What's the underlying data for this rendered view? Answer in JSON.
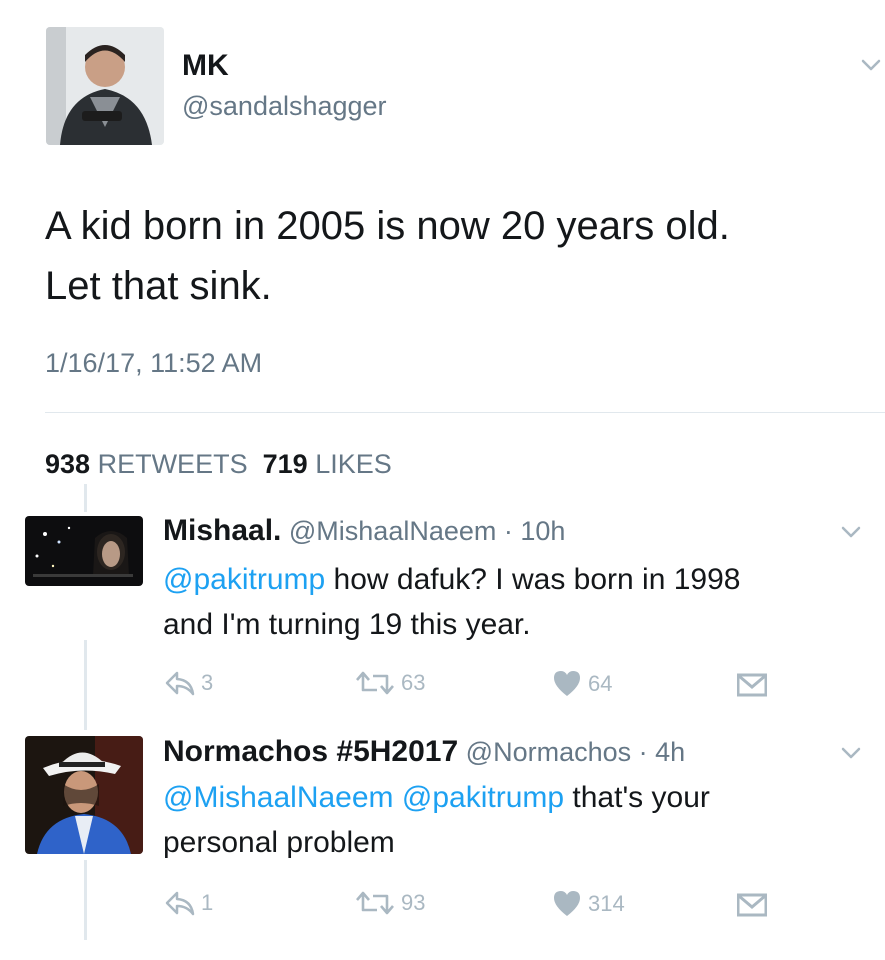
{
  "main_tweet": {
    "name": "MK",
    "handle": "@sandalshagger",
    "text_line1": "A kid born in 2005 is now 20 years old.",
    "text_line2": "Let that sink.",
    "timestamp": "1/16/17, 11:52 AM",
    "retweets_count": "938",
    "retweets_label": "RETWEETS",
    "likes_count": "719",
    "likes_label": "LIKES"
  },
  "replies": [
    {
      "name": "Mishaal.",
      "handle": "@MishaalNaeem",
      "time": "· 10h",
      "mention": "@pakitrump",
      "text_line1_rest": " how dafuk? I was born in 1998",
      "text_line2": "and I'm turning 19 this year.",
      "reply_count": "3",
      "retweet_count": "63",
      "like_count": "64"
    },
    {
      "name": "Normachos #5H2017",
      "handle": "@Normachos",
      "time": "· 4h",
      "mention1": "@MishaalNaeem",
      "mention2": "@pakitrump",
      "text_line1_rest": " that's your",
      "text_line2": "personal problem",
      "reply_count": "1",
      "retweet_count": "93",
      "like_count": "314"
    }
  ],
  "icons": {
    "caret": "chevron-down-icon",
    "reply": "reply-icon",
    "retweet": "retweet-icon",
    "like": "heart-icon",
    "dm": "envelope-icon"
  },
  "colors": {
    "link": "#1da1f2",
    "muted": "#657786",
    "action": "#aab8c2",
    "divider": "#e1e8ed"
  }
}
